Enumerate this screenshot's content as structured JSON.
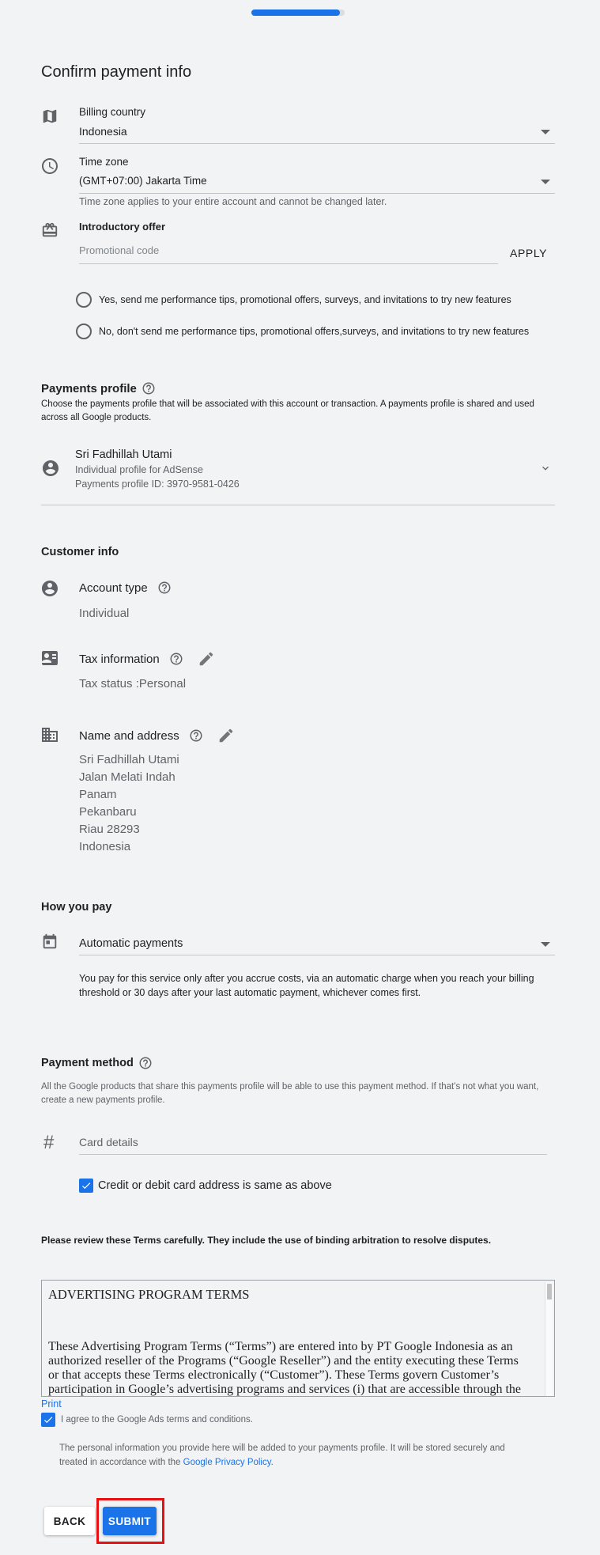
{
  "progress": {
    "fraction": 0.95
  },
  "page_title": "Confirm payment info",
  "billing_country": {
    "label": "Billing country",
    "value": "Indonesia"
  },
  "time_zone": {
    "label": "Time zone",
    "value": "(GMT+07:00) Jakarta Time",
    "note": "Time zone applies to your entire account and cannot be changed later."
  },
  "intro_offer": {
    "label": "Introductory offer",
    "placeholder": "Promotional code",
    "apply_label": "APPLY"
  },
  "emails": {
    "yes_label": "Yes, send me performance tips, promotional offers, surveys, and invitations to try new features",
    "no_label": "No, don't send me performance tips, promotional offers,surveys, and invitations to try new features"
  },
  "payments_profile": {
    "title": "Payments profile",
    "description": "Choose the payments profile that will be associated with this account or transaction. A payments profile is shared and used across all Google products.",
    "name": "Sri Fadhillah Utami",
    "type": "Individual profile for AdSense",
    "id_text": "Payments profile ID: 3970-9581-0426"
  },
  "customer_info": {
    "title": "Customer info",
    "account_type_label": "Account type",
    "account_type_value": "Individual",
    "tax_label": "Tax information",
    "tax_status_label": "Tax status :",
    "tax_status_value": "Personal",
    "name_address_label": "Name and address",
    "address_lines": [
      "Sri Fadhillah Utami",
      "Jalan Melati Indah",
      "Panam",
      "Pekanbaru",
      "Riau 28293",
      "Indonesia"
    ]
  },
  "how_you_pay": {
    "title": "How you pay",
    "value": "Automatic payments",
    "description": "You pay for this service only after you accrue costs, via an automatic charge when you reach your billing threshold or 30 days after your last automatic payment, whichever comes first."
  },
  "payment_method": {
    "title": "Payment method",
    "description": "All the Google products that share this payments profile will be able to use this payment method. If that's not what you want, create a new payments profile.",
    "card_placeholder": "Card details",
    "same_address_label": "Credit or debit card address is same as above"
  },
  "terms": {
    "notice": "Please review these Terms carefully. They include the use of binding arbitration to resolve disputes.",
    "heading": "ADVERTISING PROGRAM TERMS",
    "body": "These Advertising Program Terms (“Terms”) are entered into by PT Google Indonesia as an authorized reseller of the Programs (“Google Reseller”) and the entity executing these Terms or that accepts these Terms electronically (“Customer”).  These Terms govern Customer’s participation in Google’s advertising programs and services (i) that are accessible through the",
    "print_label": "Print",
    "agree_label": "I agree to the Google Ads terms and conditions.",
    "privacy_text": "The personal information you provide here will be added to your payments profile. It will be stored securely and treated in accordance with the",
    "privacy_link": "Google Privacy Policy",
    "privacy_end": "."
  },
  "buttons": {
    "back_label": "BACK",
    "submit_label": "SUBMIT"
  },
  "colors": {
    "accent": "#1a73e8",
    "highlight_border": "#e81010",
    "background": "#f1f3f4"
  }
}
